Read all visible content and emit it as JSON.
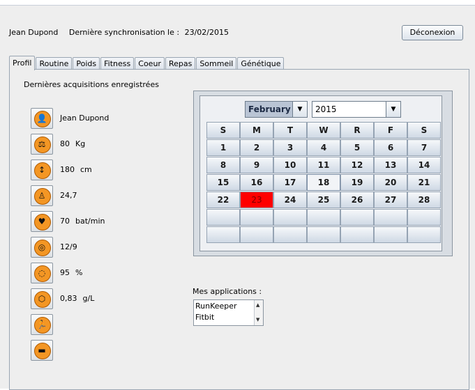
{
  "header": {
    "user_name": "Jean Dupond",
    "sync_label": "Dernière synchronisation le :",
    "sync_date": "23/02/2015",
    "logout_label": "Déconexion"
  },
  "tabs": [
    "Profil",
    "Routine",
    "Poids",
    "Fitness",
    "Coeur",
    "Repas",
    "Sommeil",
    "Génétique"
  ],
  "active_tab": "Profil",
  "panel": {
    "title": "Dernières acquisitions enregistrées",
    "acquisitions": [
      {
        "icon": "user-icon",
        "glyph": "👤",
        "value": "Jean Dupond",
        "unit": ""
      },
      {
        "icon": "weight-scale-icon",
        "glyph": "⚖",
        "value": "80",
        "unit": "Kg"
      },
      {
        "icon": "height-icon",
        "glyph": "↕",
        "value": "180",
        "unit": "cm"
      },
      {
        "icon": "body-icon",
        "glyph": "♙",
        "value": "24,7",
        "unit": ""
      },
      {
        "icon": "heart-rate-icon",
        "glyph": "♥",
        "value": "70",
        "unit": "bat/min"
      },
      {
        "icon": "blood-pressure-icon",
        "glyph": "◎",
        "value": "12/9",
        "unit": ""
      },
      {
        "icon": "oxygen-icon",
        "glyph": "◌",
        "value": "95",
        "unit": "%"
      },
      {
        "icon": "glucose-icon",
        "glyph": "⬡",
        "value": "0,83",
        "unit": "g/L"
      },
      {
        "icon": "running-icon",
        "glyph": "🏃",
        "value": "",
        "unit": ""
      },
      {
        "icon": "sleep-bed-icon",
        "glyph": "▬",
        "value": "",
        "unit": ""
      }
    ]
  },
  "calendar": {
    "month": "February",
    "year": "2015",
    "weekdays": [
      "S",
      "M",
      "T",
      "W",
      "R",
      "F",
      "S"
    ],
    "days": [
      [
        "1",
        "2",
        "3",
        "4",
        "5",
        "6",
        "7"
      ],
      [
        "8",
        "9",
        "10",
        "11",
        "12",
        "13",
        "14"
      ],
      [
        "15",
        "16",
        "17",
        "18",
        "19",
        "20",
        "21"
      ],
      [
        "22",
        "23",
        "24",
        "25",
        "26",
        "27",
        "28"
      ],
      [
        "",
        "",
        "",
        "",
        "",
        "",
        ""
      ],
      [
        "",
        "",
        "",
        "",
        "",
        "",
        ""
      ]
    ],
    "today": "18",
    "selected": "23",
    "selected_color": "#ff0000"
  },
  "apps": {
    "label": "Mes applications :",
    "items": [
      "RunKeeper",
      "Fitbit"
    ]
  }
}
